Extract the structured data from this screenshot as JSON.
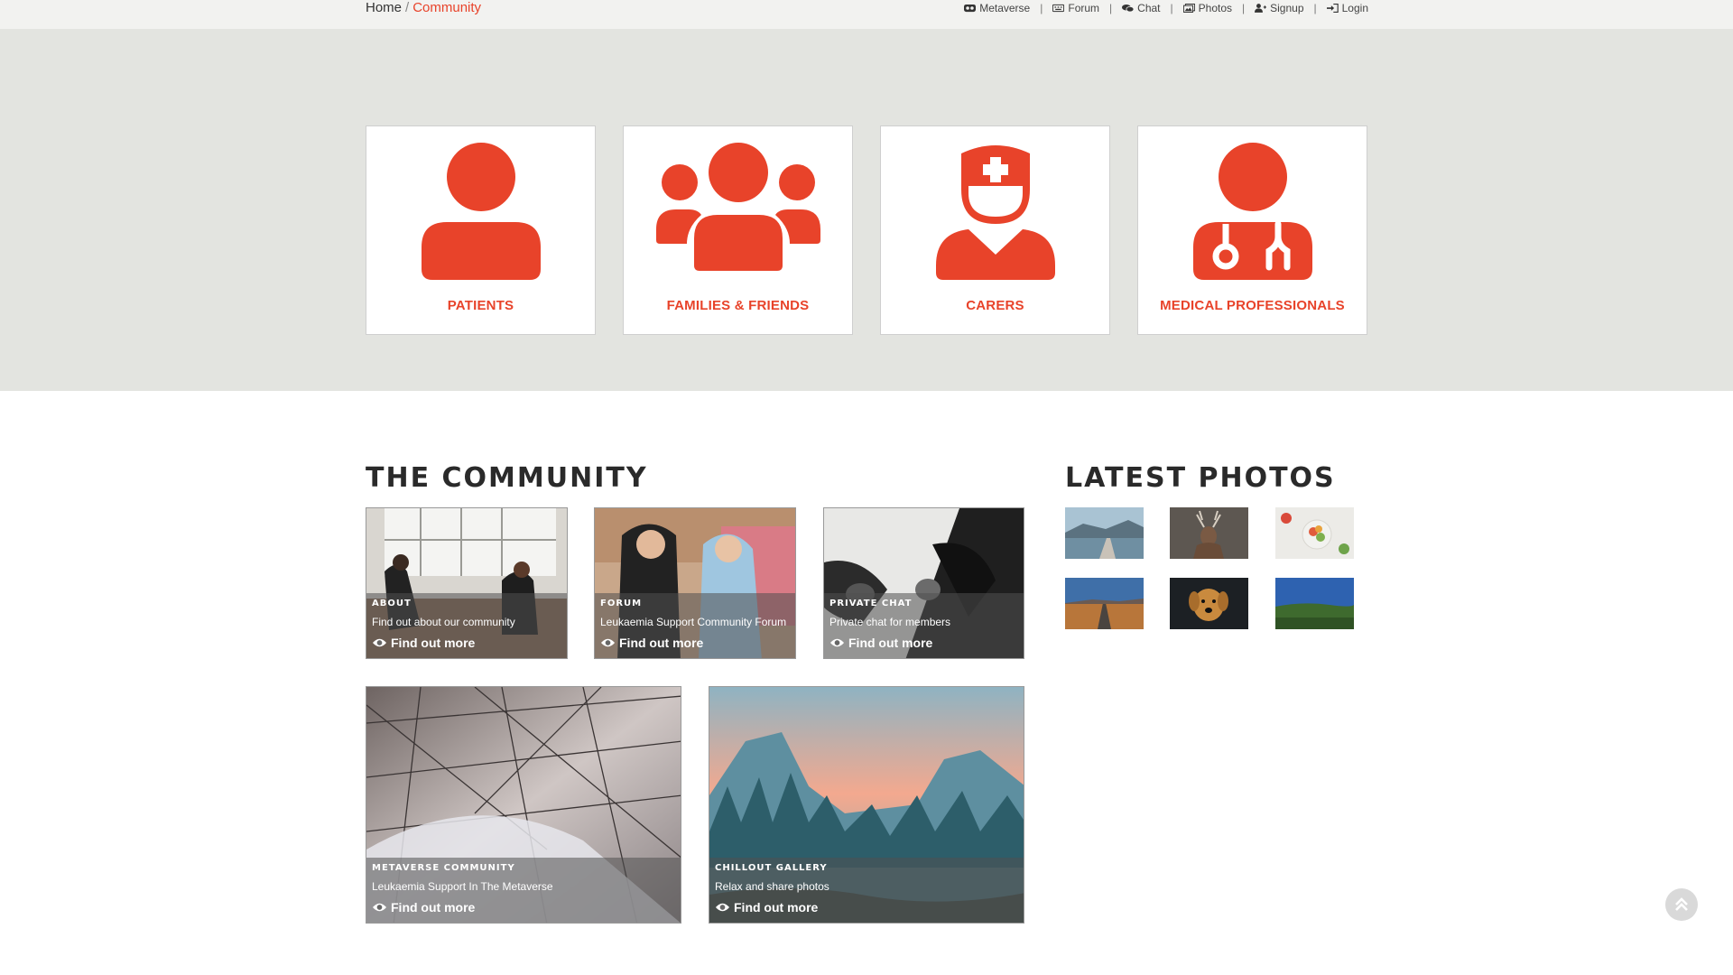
{
  "breadcrumb": {
    "home": "Home",
    "separator": "/",
    "current": "Community"
  },
  "topnav": [
    {
      "label": "Metaverse",
      "icon": "vr-headset-icon"
    },
    {
      "label": "Forum",
      "icon": "keyboard-icon"
    },
    {
      "label": "Chat",
      "icon": "comments-icon"
    },
    {
      "label": "Photos",
      "icon": "images-icon"
    },
    {
      "label": "Signup",
      "icon": "user-plus-icon"
    },
    {
      "label": "Login",
      "icon": "sign-in-icon"
    }
  ],
  "categories": [
    {
      "label": "PATIENTS",
      "icon": "user-icon"
    },
    {
      "label": "FAMILIES & FRIENDS",
      "icon": "users-icon"
    },
    {
      "label": "CARERS",
      "icon": "nurse-icon"
    },
    {
      "label": "MEDICAL PROFESSIONALS",
      "icon": "doctor-icon"
    }
  ],
  "community": {
    "title": "THE COMMUNITY",
    "tiles": [
      {
        "title": "ABOUT",
        "subtitle": "Find out about our community",
        "link": "Find out more"
      },
      {
        "title": "FORUM",
        "subtitle": "Leukaemia Support Community Forum",
        "link": "Find out more"
      },
      {
        "title": "PRIVATE CHAT",
        "subtitle": "Private chat for members",
        "link": "Find out more"
      },
      {
        "title": "METAVERSE COMMUNITY",
        "subtitle": "Leukaemia Support In The Metaverse",
        "link": "Find out more"
      },
      {
        "title": "CHILLOUT GALLERY",
        "subtitle": "Relax and share photos",
        "link": "Find out more"
      }
    ]
  },
  "latest_photos": {
    "title": "LATEST PHOTOS"
  },
  "colors": {
    "accent": "#e8432a",
    "hero_bg": "#e3e4e0",
    "topbar_bg": "#f2f2f0"
  }
}
